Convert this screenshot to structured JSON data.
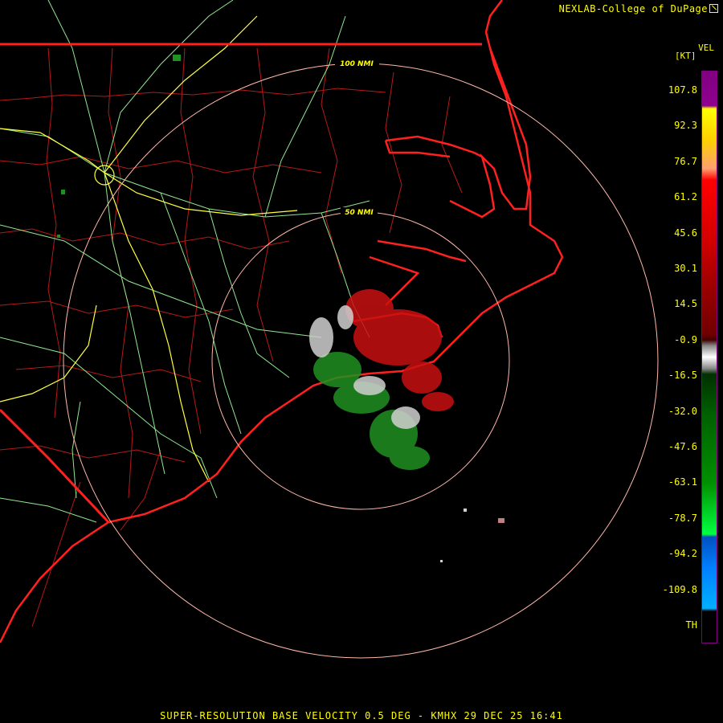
{
  "header": {
    "credit": "NEXLAB-College of DuPage",
    "logo_icon": "nexlab-logo-icon"
  },
  "legend": {
    "title": "VEL",
    "units": "[KT]",
    "labels": [
      "107.8",
      "92.3",
      "76.7",
      "61.2",
      "45.6",
      "30.1",
      "14.5",
      "-0.9",
      "-16.5",
      "-32.0",
      "-47.6",
      "-63.1",
      "-78.7",
      "-94.2",
      "-109.8",
      "TH"
    ]
  },
  "range_rings": {
    "inner_label": "50 NMI",
    "outer_label": "100 NMI"
  },
  "footer": {
    "product_line": "SUPER-RESOLUTION BASE VELOCITY 0.5 DEG - KMHX 29 DEC 25 16:41"
  },
  "colors": {
    "background": "#000000",
    "text": "#ffff00",
    "state_lines": "#ff2020",
    "county_lines": "#c01818",
    "highways": "#90ee90",
    "interstates": "#ffff40",
    "range_rings": "#ffb0a0",
    "inbound": "#20a020",
    "outbound": "#d01010",
    "near_zero": "#d8d8d8"
  }
}
